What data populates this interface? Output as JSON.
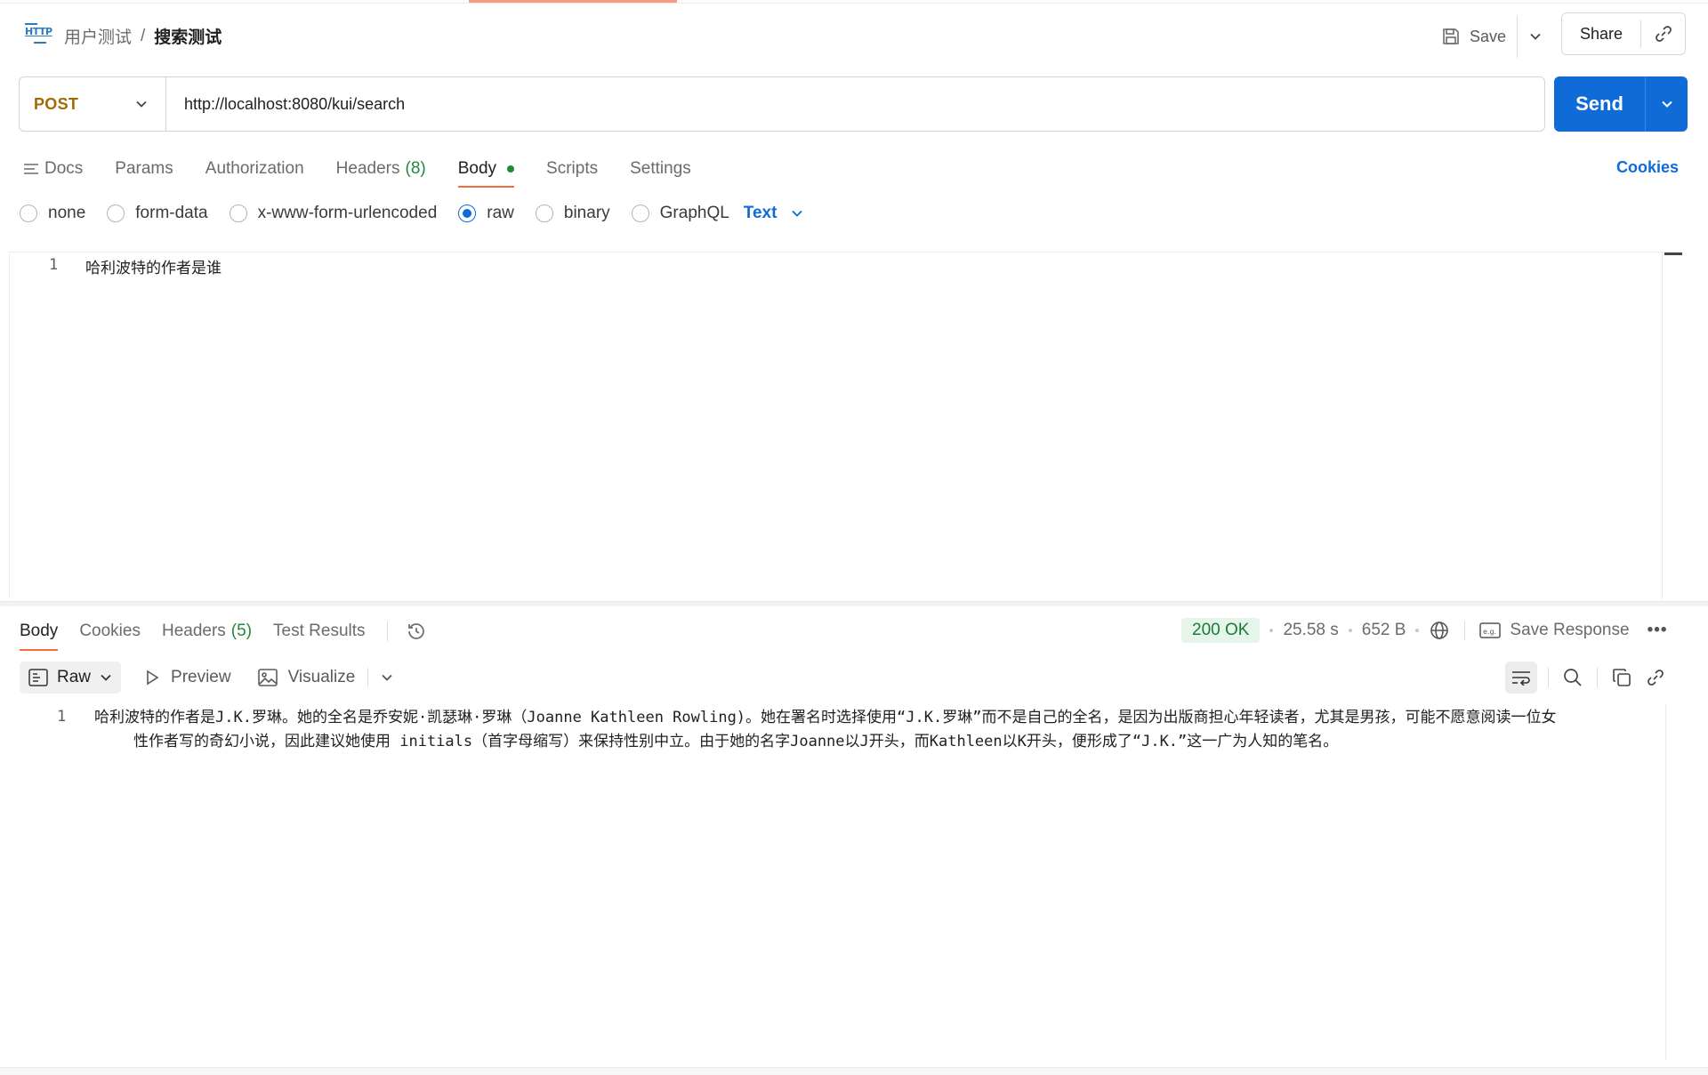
{
  "breadcrumb": {
    "icon": "http-icon",
    "parent": "用户测试",
    "separator": "/",
    "current": "搜索测试"
  },
  "header": {
    "save_label": "Save",
    "share_label": "Share"
  },
  "request": {
    "method": "POST",
    "url": "http://localhost:8080/kui/search",
    "send_label": "Send",
    "tabs": [
      {
        "label": "Docs"
      },
      {
        "label": "Params"
      },
      {
        "label": "Authorization"
      },
      {
        "label": "Headers",
        "count": "(8)"
      },
      {
        "label": "Body",
        "active": true,
        "indicator": "green-dot"
      },
      {
        "label": "Scripts"
      },
      {
        "label": "Settings"
      }
    ],
    "cookies_label": "Cookies",
    "body_types": [
      "none",
      "form-data",
      "x-www-form-urlencoded",
      "raw",
      "binary",
      "GraphQL"
    ],
    "selected_body_type": "raw",
    "format": "Text",
    "body_lines": [
      {
        "num": "1",
        "text": "哈利波特的作者是谁"
      }
    ]
  },
  "response": {
    "tabs": [
      {
        "label": "Body",
        "active": true
      },
      {
        "label": "Cookies"
      },
      {
        "label": "Headers",
        "count": "(5)"
      },
      {
        "label": "Test Results"
      }
    ],
    "status": "200 OK",
    "time": "25.58 s",
    "size": "652 B",
    "save_response_label": "Save Response",
    "view_modes": [
      "Raw",
      "Preview",
      "Visualize"
    ],
    "line_num": "1",
    "text_line1": "哈利波特的作者是J.K.罗琳。她的全名是乔安妮·凯瑟琳·罗琳（Joanne Kathleen Rowling)。她在署名时选择使用“J.K.罗琳”而不是自己的全名，是因为出版商担心年轻读者，尤其是男孩，可能不愿意阅读一位女",
    "text_line2": "性作者写的奇幻小说，因此建议她使用 initials（首字母缩写）来保持性别中立。由于她的名字Joanne以J开头，而Kathleen以K开头，便形成了“J.K.”这一广为人知的笔名。"
  },
  "colors": {
    "accent": "#f26b3a",
    "primary": "#0f6bd8",
    "method": "#a26a00",
    "success": "#1d8a3b"
  }
}
